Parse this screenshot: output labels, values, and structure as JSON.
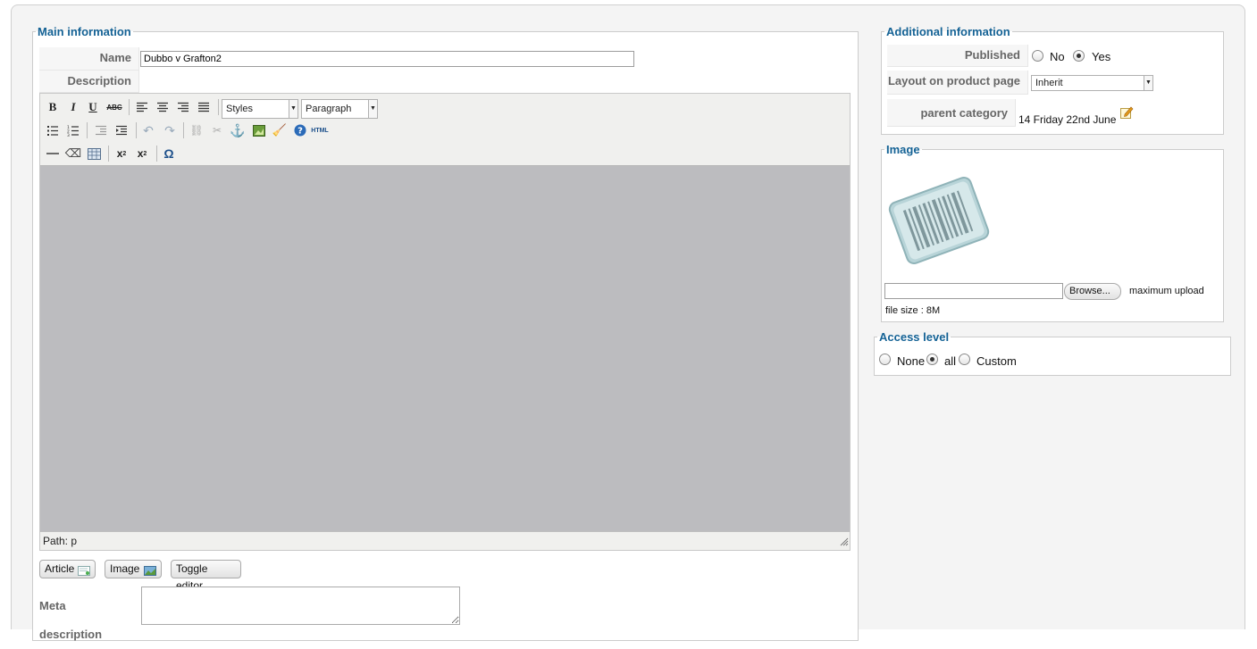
{
  "main_info": {
    "legend": "Main information",
    "name_label": "Name",
    "name_value": "Dubbo v Grafton2",
    "description_label": "Description",
    "editor": {
      "styles_select": "Styles",
      "format_select": "Paragraph",
      "path_text": "Path: p",
      "toolbar_row1": [
        "bold-icon",
        "italic-icon",
        "underline-icon",
        "strikethrough-icon",
        "align-left-icon",
        "align-center-icon",
        "align-right-icon",
        "align-justify-icon"
      ],
      "toolbar_row2": [
        "bullet-list-icon",
        "numbered-list-icon",
        "outdent-icon",
        "indent-icon",
        "undo-icon",
        "redo-icon",
        "link-icon",
        "unlink-icon",
        "anchor-icon",
        "insert-image-icon",
        "cleanup-icon",
        "help-icon",
        "html-source-icon"
      ],
      "toolbar_row3": [
        "horizontal-rule-icon",
        "remove-format-icon",
        "table-icon",
        "subscript-icon",
        "superscript-icon",
        "special-char-icon"
      ]
    },
    "buttons": {
      "article": "Article",
      "image": "Image",
      "toggle_editor": "Toggle editor"
    },
    "meta_description_label": "Meta description"
  },
  "additional_info": {
    "legend": "Additional information",
    "published_label": "Published",
    "published_no": "No",
    "published_yes": "Yes",
    "published_value": "Yes",
    "layout_label": "Layout on product page",
    "layout_value": "Inherit",
    "parent_category_label": "parent category",
    "parent_category_value": "14 Friday 22nd June"
  },
  "image_section": {
    "legend": "Image",
    "browse_button": "Browse...",
    "upload_note_1": "maximum upload",
    "upload_note_2": "file size : 8M"
  },
  "access_level": {
    "legend": "Access level",
    "options": [
      "None",
      "all",
      "Custom"
    ],
    "selected": "all"
  },
  "colors": {
    "legend": "#146295",
    "editor_area": "#bcbcbf",
    "panel_bg": "#f4f4f4"
  }
}
